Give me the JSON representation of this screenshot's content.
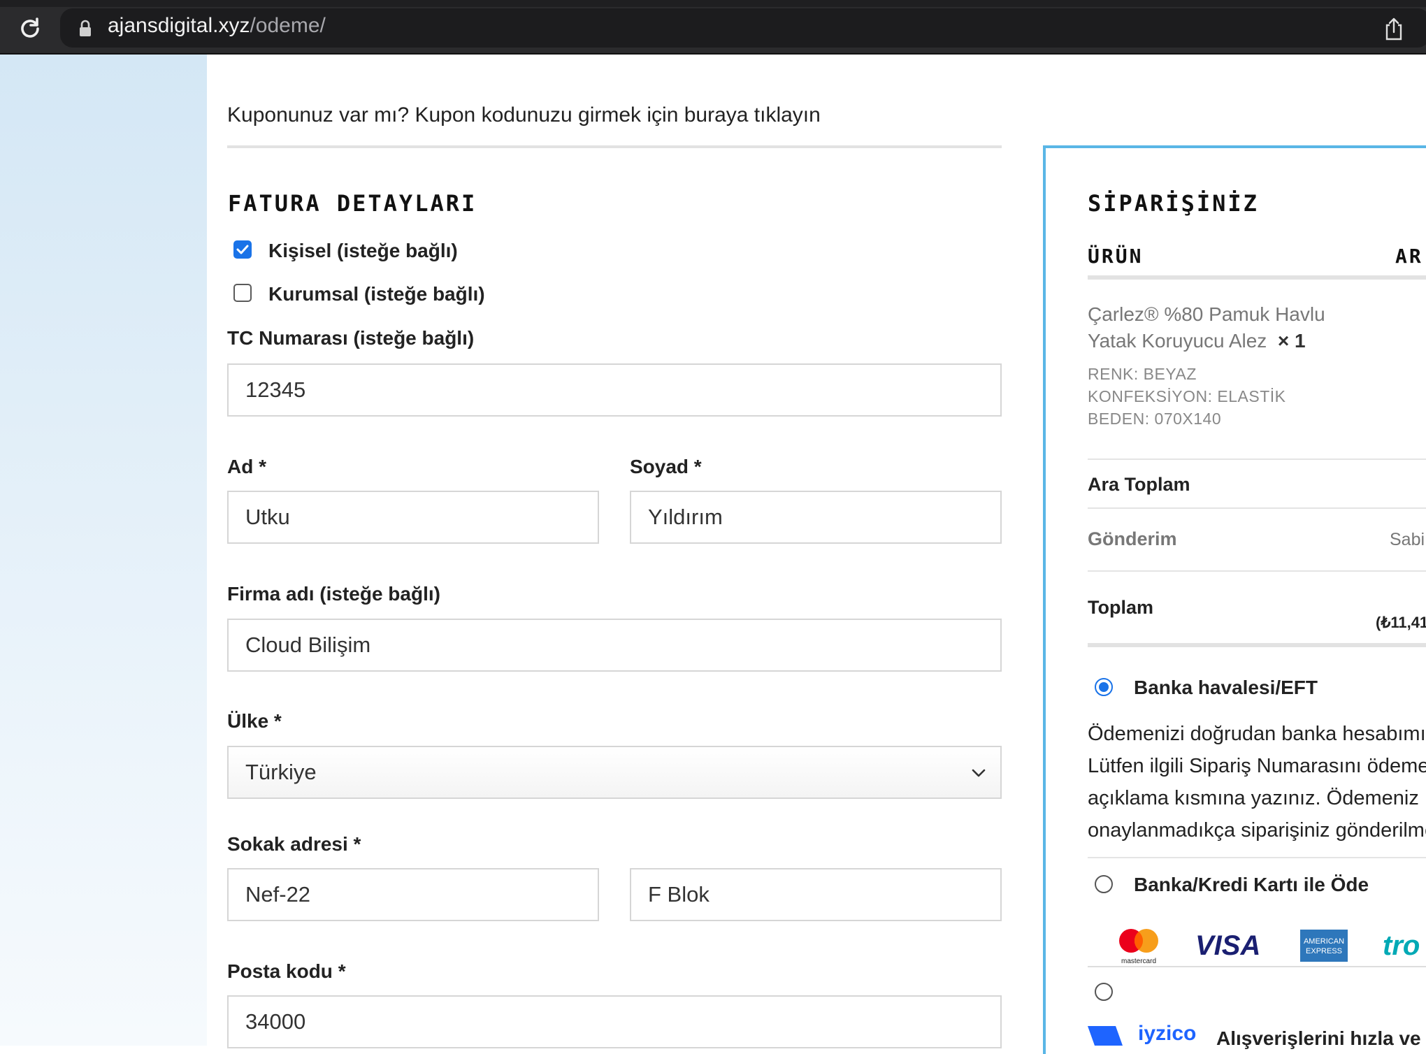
{
  "browser": {
    "domain": "ajansdigital.xyz",
    "path": "/odeme/",
    "icons": [
      "reload-icon",
      "lock-icon",
      "share-icon"
    ]
  },
  "coupon": {
    "text": "Kuponunuz var mı? Kupon kodunuzu girmek için buraya tıklayın"
  },
  "billing": {
    "title": "FATURA DETAYLARI",
    "personal_label": "Kişisel (isteğe bağlı)",
    "personal_checked": true,
    "corporate_label": "Kurumsal (isteğe bağlı)",
    "corporate_checked": false,
    "tc_label": "TC Numarası (isteğe bağlı)",
    "tc_value": "12345",
    "first_name_label": "Ad *",
    "first_name_value": "Utku",
    "last_name_label": "Soyad *",
    "last_name_value": "Yıldırım",
    "company_label": "Firma adı (isteğe bağlı)",
    "company_value": "Cloud Bilişim",
    "country_label": "Ülke *",
    "country_value": "Türkiye",
    "street_label": "Sokak adresi *",
    "street_value_1": "Nef-22",
    "street_value_2": "F Blok",
    "postcode_label": "Posta kodu *",
    "postcode_value": "34000"
  },
  "order": {
    "title": "SİPARİŞİNİZ",
    "col_product": "ÜRÜN",
    "col_subtotal": "AR",
    "product_line1": "Çarlez® %80 Pamuk Havlu",
    "product_line2": "Yatak Koruyucu Alez",
    "product_qty": "× 1",
    "attr_color": "RENK: BEYAZ",
    "attr_type": "KONFEKSİYON: ELASTİK",
    "attr_size": "BEDEN: 070X140",
    "subtotal_label": "Ara Toplam",
    "shipping_label": "Gönderim",
    "shipping_value": "Sabi",
    "total_label": "Toplam",
    "total_value": "(₺11,41",
    "pay_bank_label": "Banka havalesi/EFT",
    "pay_bank_selected": true,
    "pay_bank_desc_1": "Ödemenizi doğrudan banka hesabımız",
    "pay_bank_desc_2": "Lütfen ilgili Sipariş Numarasını ödeme",
    "pay_bank_desc_3": "açıklama kısmına yazınız. Ödemeniz",
    "pay_bank_desc_4": "onaylanmadıkça siparişiniz gönderilme",
    "pay_card_label": "Banka/Kredi Kartı ile Öde",
    "card_logos": {
      "mastercard": "mastercard",
      "visa": "VISA",
      "amex_1": "AMERICAN",
      "amex_2": "EXPRESS",
      "troy": "tro"
    },
    "iyzico_brand": "iyzico",
    "iyzico_text": "Alışverişlerini hızla ve"
  },
  "colors": {
    "accent_blue": "#1a73e8",
    "panel_border": "#5ab6e6",
    "browser_bar": "#2b2b2d"
  }
}
